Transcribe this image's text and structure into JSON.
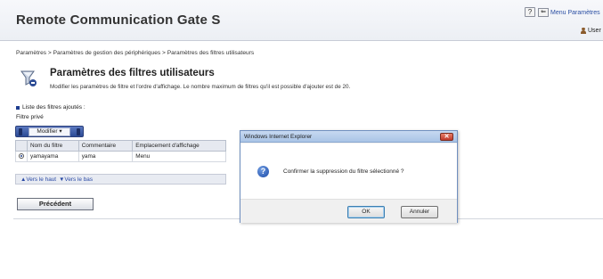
{
  "app": {
    "title": "Remote Communication Gate S",
    "help_label": "?",
    "menu_label": "Menu Paramètres",
    "user_label": "User"
  },
  "breadcrumb": "Paramètres > Paramètres de gestion des périphériques > Paramètres des filtres utilisateurs",
  "page": {
    "title": "Paramètres des filtres utilisateurs",
    "description": "Modifier les paramètres de filtre et l'ordre d'affichage. Le nombre maximum de filtres qu'il est possible d'ajouter est de 20.",
    "filters_list_label": "Liste des filtres ajoutés :",
    "filter_kind": "Filtre privé",
    "modify_button": "Modifier ▾",
    "table": {
      "headers": [
        "Nom du filtre",
        "Commentaire",
        "Emplacement d'affichage"
      ],
      "rows": [
        {
          "name": "yamayama",
          "comment": "yama",
          "location": "Menu"
        }
      ]
    },
    "move_up": "▲Vers le haut",
    "move_down": "▼Vers le bas",
    "previous_button": "Précédent"
  },
  "dialog": {
    "title": "Windows Internet Explorer",
    "message": "Confirmer la suppression du filtre sélectionné ?",
    "ok_button": "OK",
    "cancel_button": "Annuler"
  },
  "icons": {
    "help": "help-icon",
    "menu": "arrow-left-icon",
    "user": "user-icon",
    "page": "filter-icon",
    "question": "question-icon",
    "close": "close-icon"
  },
  "colors": {
    "accent": "#2c4b95",
    "link": "#2a4aa5",
    "dialog_title": "#a9c4e6",
    "close": "#c0382a"
  }
}
